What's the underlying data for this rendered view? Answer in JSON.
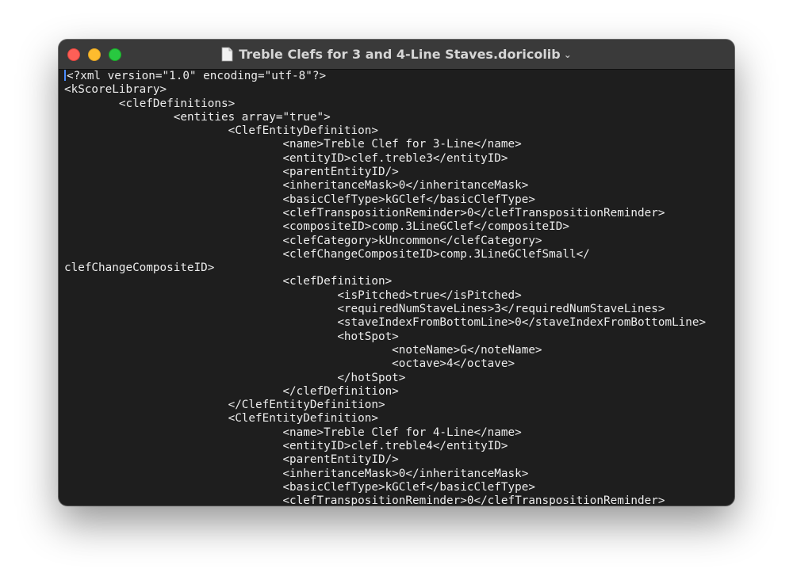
{
  "window": {
    "title": "Treble Clefs for 3 and 4-Line Staves.doricolib",
    "title_chevron": "⌄",
    "buttons": [
      "close",
      "minimize",
      "zoom"
    ],
    "colors": {
      "close": "#fe5f57",
      "minimize": "#febc2e",
      "zoom": "#28c840",
      "background": "#1e1e1e",
      "text": "#ececec",
      "cursor": "#4a8cff"
    }
  },
  "terminal": {
    "lines": [
      "<?xml version=\"1.0\" encoding=\"utf-8\"?>",
      "<kScoreLibrary>",
      "\t<clefDefinitions>",
      "\t\t<entities array=\"true\">",
      "\t\t\t<ClefEntityDefinition>",
      "\t\t\t\t<name>Treble Clef for 3-Line</name>",
      "\t\t\t\t<entityID>clef.treble3</entityID>",
      "\t\t\t\t<parentEntityID/>",
      "\t\t\t\t<inheritanceMask>0</inheritanceMask>",
      "\t\t\t\t<basicClefType>kGClef</basicClefType>",
      "\t\t\t\t<clefTranspositionReminder>0</clefTranspositionReminder>",
      "\t\t\t\t<compositeID>comp.3LineGClef</compositeID>",
      "\t\t\t\t<clefCategory>kUncommon</clefCategory>",
      "\t\t\t\t<clefChangeCompositeID>comp.3LineGClefSmall</",
      "clefChangeCompositeID>",
      "\t\t\t\t<clefDefinition>",
      "\t\t\t\t\t<isPitched>true</isPitched>",
      "\t\t\t\t\t<requiredNumStaveLines>3</requiredNumStaveLines>",
      "\t\t\t\t\t<staveIndexFromBottomLine>0</staveIndexFromBottomLine>",
      "\t\t\t\t\t<hotSpot>",
      "\t\t\t\t\t\t<noteName>G</noteName>",
      "\t\t\t\t\t\t<octave>4</octave>",
      "\t\t\t\t\t</hotSpot>",
      "\t\t\t\t</clefDefinition>",
      "\t\t\t</ClefEntityDefinition>",
      "\t\t\t<ClefEntityDefinition>",
      "\t\t\t\t<name>Treble Clef for 4-Line</name>",
      "\t\t\t\t<entityID>clef.treble4</entityID>",
      "\t\t\t\t<parentEntityID/>",
      "\t\t\t\t<inheritanceMask>0</inheritanceMask>",
      "\t\t\t\t<basicClefType>kGClef</basicClefType>",
      "\t\t\t\t<clefTranspositionReminder>0</clefTranspositionReminder>"
    ]
  }
}
